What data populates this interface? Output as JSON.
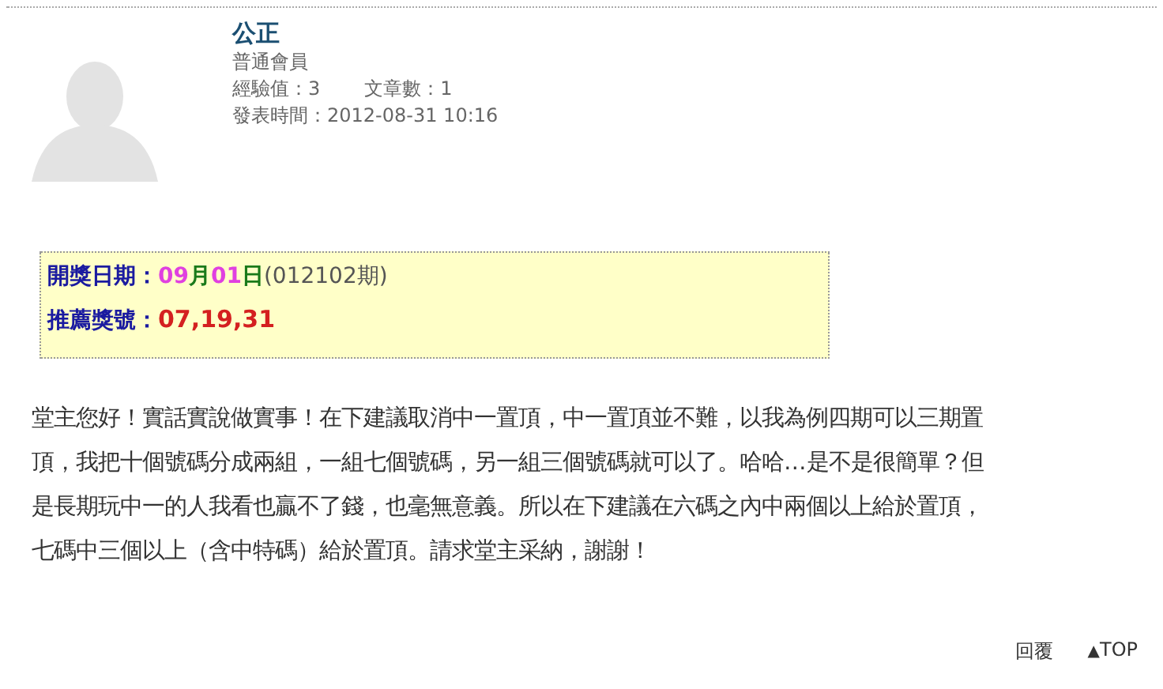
{
  "author": {
    "name": "公正",
    "rank": "普通會員",
    "stats": [
      {
        "label": "經驗值：",
        "value": "3"
      },
      {
        "label": "文章數：",
        "value": "1"
      }
    ],
    "posted": "發表時間：2012-08-31 10:16"
  },
  "draw": {
    "date_label": "開獎日期：",
    "date_parts": [
      {
        "text": "09",
        "kind": "number"
      },
      {
        "text": "月",
        "kind": "unit"
      },
      {
        "text": "01",
        "kind": "number"
      },
      {
        "text": "日",
        "kind": "unit"
      },
      {
        "text": "(012102期)",
        "kind": "period"
      }
    ],
    "numbers_label": "推薦獎號：",
    "numbers": "07,19,31"
  },
  "body": [
    "堂主您好！實話實說做實事！在下建議取消中一置頂，中一置頂並不難，以我為例四期可以三期置",
    "頂，我把十個號碼分成兩組，一組七個號碼，另一組三個號碼就可以了。哈哈…是不是很簡單？但",
    "是長期玩中一的人我看也贏不了錢，也毫無意義。所以在下建議在六碼之內中兩個以上給於置頂，",
    "七碼中三個以上（含中特碼）給於置頂。請求堂主采納，謝謝！"
  ],
  "footer": {
    "reply": "回覆",
    "top_arrow": "▲",
    "top": "TOP"
  }
}
